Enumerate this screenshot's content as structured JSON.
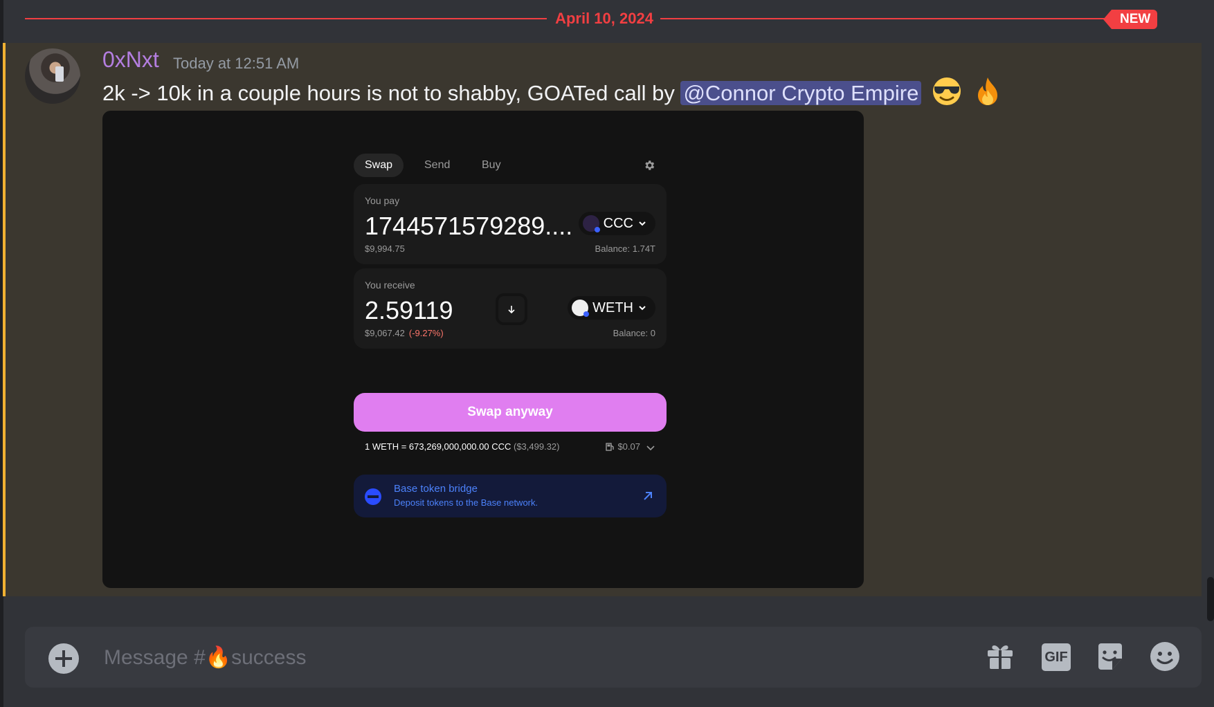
{
  "divider": {
    "date": "April 10, 2024",
    "badge": "NEW"
  },
  "message": {
    "username": "0xNxt",
    "timestamp": "Today at 12:51 AM",
    "text": "2k -> 10k in a couple hours is not to shabby, GOATed call by ",
    "mention": "@Connor Crypto Empire",
    "emojis": [
      "sunglasses-emoji",
      "fire-emoji"
    ]
  },
  "swap_widget": {
    "tabs": [
      "Swap",
      "Send",
      "Buy"
    ],
    "pay": {
      "label": "You pay",
      "amount": "1744571579289....",
      "token": "CCC",
      "usd": "$9,994.75",
      "balance": "Balance: 1.74T"
    },
    "receive": {
      "label": "You receive",
      "amount": "2.59119",
      "token": "WETH",
      "usd": "$9,067.42",
      "price_impact": "(-9.27%)",
      "balance": "Balance: 0"
    },
    "swap_button": "Swap anyway",
    "rate": "1 WETH = 673,269,000,000.00 CCC",
    "rate_usd": "($3,499.32)",
    "gas": "$0.07",
    "bridge": {
      "title": "Base token bridge",
      "subtitle": "Deposit tokens to the Base network."
    }
  },
  "composer": {
    "placeholder": "Message #🔥success",
    "gif_label": "GIF"
  },
  "colors": {
    "accent_red": "#f23f42",
    "username": "#b47ee0",
    "mention_bg": "#4b4f8c",
    "swap_button": "#e07ef0",
    "bridge_text": "#4c82fb"
  }
}
